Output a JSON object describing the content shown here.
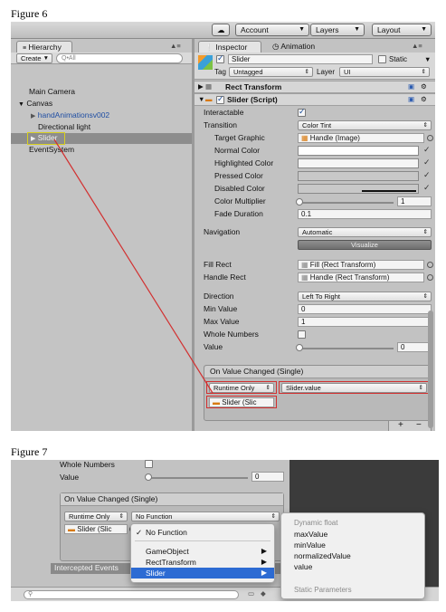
{
  "figure6": {
    "label": "Figure 6",
    "toolbar": {
      "account": "Account",
      "layers": "Layers",
      "layout": "Layout"
    },
    "hierarchy": {
      "tab": "Hierarchy",
      "create": "Create",
      "search_placeholder": "Q•All",
      "items": [
        {
          "label": "Main Camera"
        },
        {
          "label": "Canvas"
        },
        {
          "label": "handAnimationsv002"
        },
        {
          "label": "Directional light"
        },
        {
          "label": "Slider"
        },
        {
          "label": "EventSystem"
        }
      ]
    },
    "inspector": {
      "tab": "Inspector",
      "tab_animation": "Animation",
      "object_name": "Slider",
      "static_label": "Static",
      "tag_label": "Tag",
      "tag_value": "Untagged",
      "layer_label": "Layer",
      "layer_value": "UI",
      "rect_transform": "Rect Transform",
      "slider_script": "Slider (Script)",
      "rows": {
        "interactable": "Interactable",
        "transition": "Transition",
        "transition_value": "Color Tint",
        "target_graphic": "Target Graphic",
        "target_graphic_value": "Handle (Image)",
        "normal_color": "Normal Color",
        "highlighted_color": "Highlighted Color",
        "pressed_color": "Pressed Color",
        "disabled_color": "Disabled Color",
        "color_multiplier": "Color Multiplier",
        "color_multiplier_value": "1",
        "fade_duration": "Fade Duration",
        "fade_duration_value": "0.1",
        "navigation": "Navigation",
        "navigation_value": "Automatic",
        "visualize": "Visualize",
        "fill_rect": "Fill Rect",
        "fill_rect_value": "Fill (Rect Transform)",
        "handle_rect": "Handle Rect",
        "handle_rect_value": "Handle (Rect Transform)",
        "direction": "Direction",
        "direction_value": "Left To Right",
        "min_value": "Min Value",
        "min_value_value": "0",
        "max_value": "Max Value",
        "max_value_value": "1",
        "whole_numbers": "Whole Numbers",
        "value": "Value",
        "value_value": "0"
      },
      "event_header": "On Value Changed (Single)",
      "runtime": "Runtime Only",
      "function": "Slider.value",
      "object_ref": "Slider (Slic",
      "plus": "+",
      "minus": "−"
    }
  },
  "figure7": {
    "label": "Figure 7",
    "whole_numbers": "Whole Numbers",
    "value": "Value",
    "value_value": "0",
    "event_header": "On Value Changed (Single)",
    "runtime": "Runtime Only",
    "function": "No Function",
    "object_ref": "Slider (Slic",
    "intercepted": "Intercepted Events",
    "menu": {
      "items": [
        "No Function",
        "GameObject",
        "RectTransform",
        "Slider"
      ]
    },
    "submenu": {
      "dynamic_header": "Dynamic float",
      "items": [
        "maxValue",
        "minValue",
        "normalizedValue",
        "value"
      ],
      "static_header": "Static Parameters"
    }
  },
  "colors": {
    "selection_red": "#d23030",
    "menu_highlight": "#2d6bd3",
    "panel_gray": "#c2c2c2",
    "link_blue": "#1f4ea3"
  }
}
